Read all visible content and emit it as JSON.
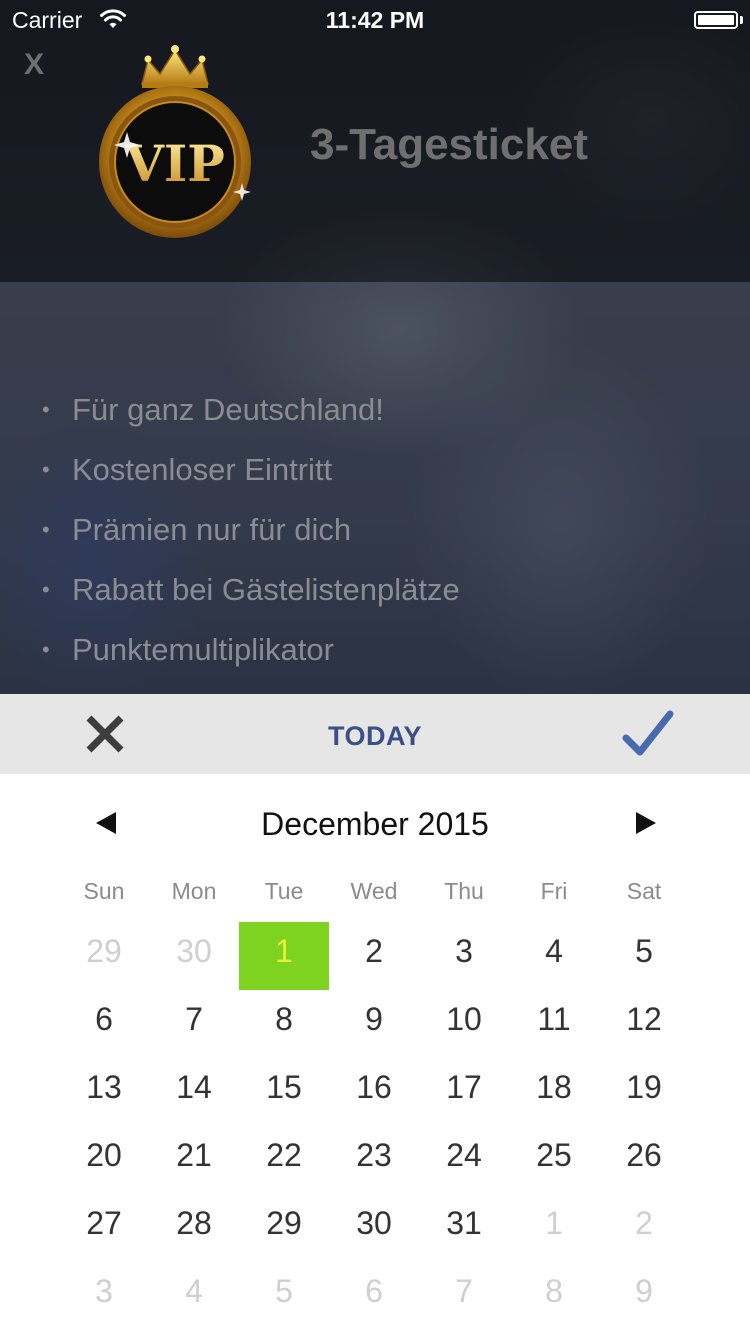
{
  "status_bar": {
    "carrier": "Carrier",
    "time": "11:42 PM"
  },
  "overlay": {
    "close_label": "X",
    "logo_text": "VIP",
    "title": "3-Tagesticket",
    "features": [
      "Für ganz Deutschland!",
      "Kostenloser Eintritt",
      "Prämien nur für dich",
      "Rabatt bei Gästelistenplätze",
      "Punktemultiplikator"
    ],
    "bullet": "•"
  },
  "picker": {
    "today_label": "TODAY",
    "accent_color": "#3a5087",
    "selected_color": "#7ed321"
  },
  "calendar": {
    "month_title": "December 2015",
    "weekdays": [
      "Sun",
      "Mon",
      "Tue",
      "Wed",
      "Thu",
      "Fri",
      "Sat"
    ],
    "weeks": [
      [
        {
          "d": "29",
          "m": true
        },
        {
          "d": "30",
          "m": true
        },
        {
          "d": "1",
          "s": true
        },
        {
          "d": "2"
        },
        {
          "d": "3"
        },
        {
          "d": "4"
        },
        {
          "d": "5"
        }
      ],
      [
        {
          "d": "6"
        },
        {
          "d": "7"
        },
        {
          "d": "8"
        },
        {
          "d": "9"
        },
        {
          "d": "10"
        },
        {
          "d": "11"
        },
        {
          "d": "12"
        }
      ],
      [
        {
          "d": "13"
        },
        {
          "d": "14"
        },
        {
          "d": "15"
        },
        {
          "d": "16"
        },
        {
          "d": "17"
        },
        {
          "d": "18"
        },
        {
          "d": "19"
        }
      ],
      [
        {
          "d": "20"
        },
        {
          "d": "21"
        },
        {
          "d": "22"
        },
        {
          "d": "23"
        },
        {
          "d": "24"
        },
        {
          "d": "25"
        },
        {
          "d": "26"
        }
      ],
      [
        {
          "d": "27"
        },
        {
          "d": "28"
        },
        {
          "d": "29"
        },
        {
          "d": "30"
        },
        {
          "d": "31"
        },
        {
          "d": "1",
          "m": true
        },
        {
          "d": "2",
          "m": true
        }
      ],
      [
        {
          "d": "3",
          "m": true
        },
        {
          "d": "4",
          "m": true
        },
        {
          "d": "5",
          "m": true
        },
        {
          "d": "6",
          "m": true
        },
        {
          "d": "7",
          "m": true
        },
        {
          "d": "8",
          "m": true
        },
        {
          "d": "9",
          "m": true
        }
      ]
    ]
  }
}
